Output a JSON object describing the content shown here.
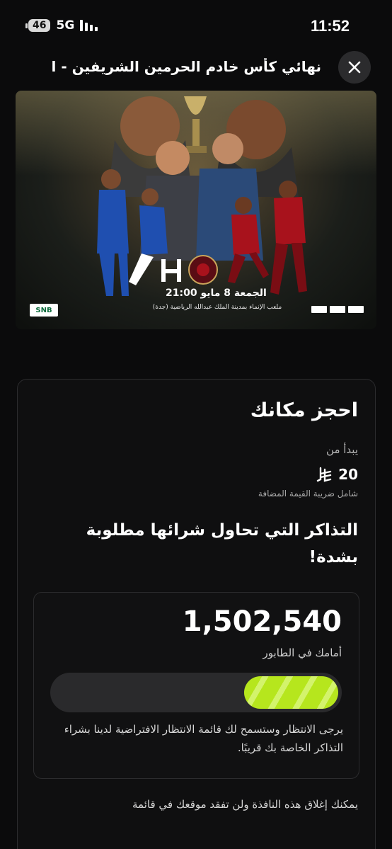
{
  "status_bar": {
    "battery": "46",
    "network": "5G",
    "time": "11:52"
  },
  "header": {
    "title": "نهائي كأس خادم الحرمين الشريفين - ال...",
    "close_icon": "close-icon"
  },
  "banner": {
    "date_time": "الجمعة 8 مايو  21:00",
    "venue": "ملعب الإنماء بمدينة الملك عبدالله الرياضية (جدة)",
    "sponsor_logo": "SNB",
    "team_logos": [
      "al-hilal-logo",
      "al-kholood-logo"
    ],
    "colors": {
      "hilal_blue": "#1f4fb0",
      "kholood_red": "#a8121c"
    }
  },
  "booking": {
    "title": "احجز مكانك",
    "starts_from": "يبدأ من",
    "price": "20",
    "currency_icon": "saudi-riyal-icon",
    "vat_note": "شامل ضريبة القيمة المضافة",
    "demand_message": "التذاكر التي تحاول شرائها مطلوبة بشدة!"
  },
  "queue": {
    "count": "1,502,540",
    "label": "أمامك في الطابور",
    "progress_fraction": 0.33,
    "progress_color": "#b6e61d",
    "note": "يرجى الانتظار وستسمح لك قائمة الانتظار الافتراضية لدينا بشراء التذاكر الخاصة بك قريبًا."
  },
  "footer": {
    "note": "يمكنك إغلاق هذه النافذة ولن تفقد موقعك في قائمة"
  }
}
